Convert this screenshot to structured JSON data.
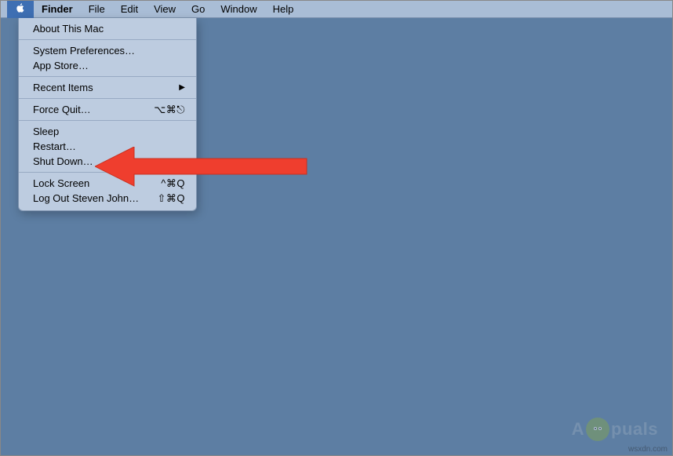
{
  "menubar": {
    "items": [
      "Finder",
      "File",
      "Edit",
      "View",
      "Go",
      "Window",
      "Help"
    ]
  },
  "apple_menu": {
    "about": "About This Mac",
    "prefs": "System Preferences…",
    "appstore": "App Store…",
    "recent": "Recent Items",
    "forcequit": {
      "label": "Force Quit…",
      "shortcut": "⌥⌘⎋"
    },
    "sleep": "Sleep",
    "restart": "Restart…",
    "shutdown": "Shut Down…",
    "lock": {
      "label": "Lock Screen",
      "shortcut": "^⌘Q"
    },
    "logout": {
      "label": "Log Out Steven John…",
      "shortcut": "⇧⌘Q"
    }
  },
  "watermark": {
    "pre": "A",
    "post": "puals"
  },
  "credit": "wsxdn.com"
}
